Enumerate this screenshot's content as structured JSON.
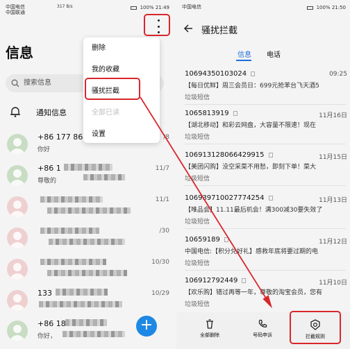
{
  "left": {
    "status": {
      "carrier": "中国电信",
      "carrier2": "中国联通",
      "speed": "317 B/s",
      "battery": "100%",
      "time": "21:49"
    },
    "title": "信息",
    "search_placeholder": "搜索信息",
    "notice_label": "通知信息",
    "menu": [
      {
        "label": "删除",
        "disabled": false
      },
      {
        "label": "我的收藏",
        "disabled": false
      },
      {
        "label": "骚扰拦截",
        "disabled": false
      },
      {
        "label": "全部已读",
        "disabled": true
      },
      {
        "label": "设置",
        "disabled": false
      }
    ],
    "conversations": [
      {
        "name": "+86 177 8640",
        "snippet": "你好",
        "date": "/8",
        "avatar": "green"
      },
      {
        "name": "+86 1",
        "snippet": "尊敬的",
        "date": "11/7",
        "avatar": "green"
      },
      {
        "name": "",
        "snippet": "",
        "date": "11/1",
        "avatar": "pink"
      },
      {
        "name": "",
        "snippet": "",
        "date": "/30",
        "avatar": "pink"
      },
      {
        "name": "",
        "snippet": "",
        "date": "10/30",
        "avatar": "pink"
      },
      {
        "name": "133",
        "snippet": "",
        "date": "10/29",
        "avatar": "pink"
      },
      {
        "name": "+86 18",
        "snippet": "你好，",
        "date": "",
        "avatar": "green"
      }
    ],
    "fab_label": "+"
  },
  "right": {
    "status": {
      "carrier": "中国电信",
      "battery": "100%",
      "time": "21:50"
    },
    "header_title": "骚扰拦截",
    "tabs": [
      {
        "label": "信息",
        "active": true
      },
      {
        "label": "电话",
        "active": false
      }
    ],
    "messages": [
      {
        "number": "10694350103024",
        "date": "09:25",
        "body": "【每日优鲜】周三会员日：699元抢苯台飞天酒5",
        "tag": "垃圾短信"
      },
      {
        "number": "1065813919",
        "date": "11月16日",
        "body": "【湖北移动】和彩云网盘，大容量不限速！现在",
        "tag": "垃圾短信"
      },
      {
        "number": "106913128066429915",
        "date": "11月15日",
        "body": "【美团闪购】没空采菜不用愁，即刻下单！菜大",
        "tag": "垃圾短信"
      },
      {
        "number": "106939710027774254",
        "date": "11月13日",
        "body": "【唯品会】11.11最后机会！满300减30要失效了",
        "tag": "垃圾短信"
      },
      {
        "number": "10659189",
        "date": "11月12日",
        "body": "中国电信:【积分兑好礼】感救年底将要过期的电",
        "tag": "垃圾短信"
      },
      {
        "number": "106912792449",
        "date": "11月10日",
        "body": "【欢乐购】错过再等一年，尊敬的淘宝会员，您有",
        "tag": "垃圾短信"
      }
    ],
    "bottom": [
      {
        "label": "全部删除",
        "icon": "trash-icon"
      },
      {
        "label": "号码申诉",
        "icon": "phone-icon"
      },
      {
        "label": "拦截规则",
        "icon": "shield-icon"
      }
    ]
  },
  "colors": {
    "accent": "#1e6fd9",
    "highlight": "#d9262b",
    "fab": "#1e88e5"
  }
}
